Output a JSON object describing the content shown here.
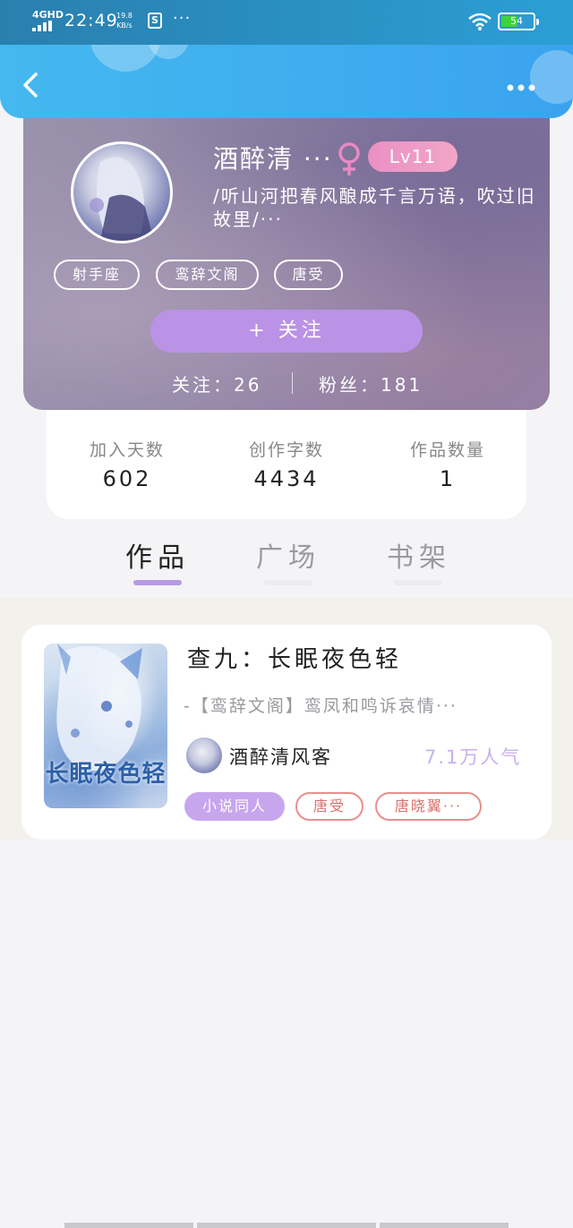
{
  "status_bar": {
    "network": "4GHD",
    "time": "22:49",
    "speed_value": "19.8",
    "speed_unit": "KB/s",
    "app_icon": "S",
    "more": "···",
    "battery": "54",
    "battery_fraction": 0.54,
    "battery_color": "#3ed23e"
  },
  "nav": {
    "back_icon": "chevron-left-icon",
    "menu_icon": "more-dots-icon",
    "color": "#45b8ef"
  },
  "profile": {
    "username": "酒醉清 ···",
    "gender_icon": "female-icon",
    "gender_color": "#e98ac2",
    "level": "Lv11",
    "bio": "/听山河把春风酿成千言万语，吹过旧故里/···",
    "tags": [
      "射手座",
      "鸾辞文阁",
      "唐受"
    ],
    "follow_button": "+   关注",
    "following": "关注：26",
    "followers": "粉丝：181"
  },
  "stats": [
    {
      "label": "加入天数",
      "value": "602"
    },
    {
      "label": "创作字数",
      "value": "4434"
    },
    {
      "label": "作品数量",
      "value": "1"
    }
  ],
  "tabs": [
    {
      "label": "作品",
      "active": true
    },
    {
      "label": "广场",
      "active": false
    },
    {
      "label": "书架",
      "active": false
    }
  ],
  "work": {
    "cover_title": "长眠夜色轻",
    "title": "查九：长眠夜色轻",
    "description": "-【鸾辞文阁】鸾凤和鸣诉哀情···",
    "author": "酒醉清风客",
    "popularity": "7.1万人气",
    "tags": [
      {
        "label": "小说同人",
        "style": "primary"
      },
      {
        "label": "唐受",
        "style": "outline"
      },
      {
        "label": "唐晓翼···",
        "style": "outline"
      }
    ]
  },
  "accent_color": "#ba92e6"
}
